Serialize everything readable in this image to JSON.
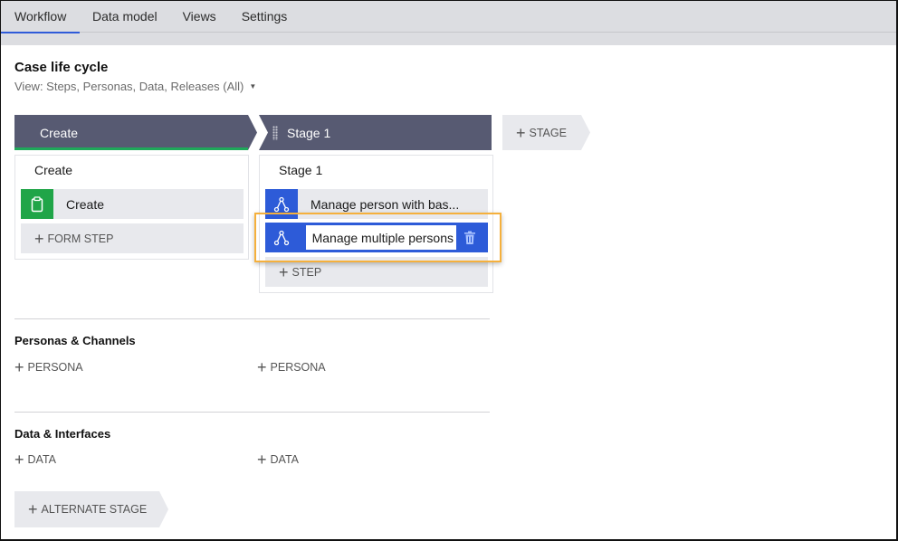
{
  "tabs": [
    {
      "label": "Workflow",
      "active": true
    },
    {
      "label": "Data model",
      "active": false
    },
    {
      "label": "Views",
      "active": false
    },
    {
      "label": "Settings",
      "active": false
    }
  ],
  "page": {
    "title": "Case life cycle",
    "view_selector": "View: Steps, Personas, Data, Releases (All)"
  },
  "stages": [
    {
      "name": "Create",
      "process": "Create",
      "steps": [
        {
          "label": "Create",
          "icon": "clipboard-icon"
        }
      ],
      "add_step_label": "FORM STEP"
    },
    {
      "name": "Stage 1",
      "process": "Stage 1",
      "steps": [
        {
          "label": "Manage person with bas...",
          "icon": "subprocess-icon"
        },
        {
          "label": "Manage multiple persons",
          "icon": "subprocess-icon",
          "editing": true
        }
      ],
      "add_step_label": "STEP"
    }
  ],
  "add_stage_label": "STAGE",
  "personas": {
    "title": "Personas & Channels",
    "add_labels": [
      "PERSONA",
      "PERSONA"
    ]
  },
  "data_section": {
    "title": "Data & Interfaces",
    "add_labels": [
      "DATA",
      "DATA"
    ]
  },
  "alternate_stage_label": "ALTERNATE STAGE",
  "colors": {
    "stage_header": "#575a72",
    "accent_blue": "#2d5bd8",
    "success_green": "#20a548",
    "highlight": "#f5b03c"
  }
}
